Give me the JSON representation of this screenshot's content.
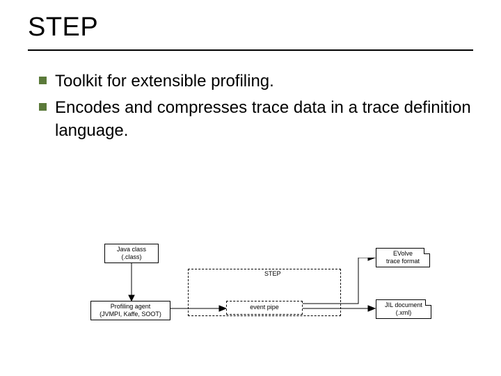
{
  "title": "STEP",
  "bullets": [
    "Toolkit for extensible profiling.",
    "Encodes and compresses trace data in a trace definition language."
  ],
  "diagram": {
    "java_class": {
      "line1": "Java class",
      "line2": "(.class)"
    },
    "evolve": {
      "line1": "EVolve",
      "line2": "trace format"
    },
    "step_label": "STEP",
    "prof_agent": {
      "line1": "Profiling agent",
      "line2": "(JVMPI, Kaffe, SOOT)"
    },
    "event_pipe": "event pipe",
    "jil_doc": {
      "line1": "JIL document",
      "line2": "(.xml)"
    }
  }
}
